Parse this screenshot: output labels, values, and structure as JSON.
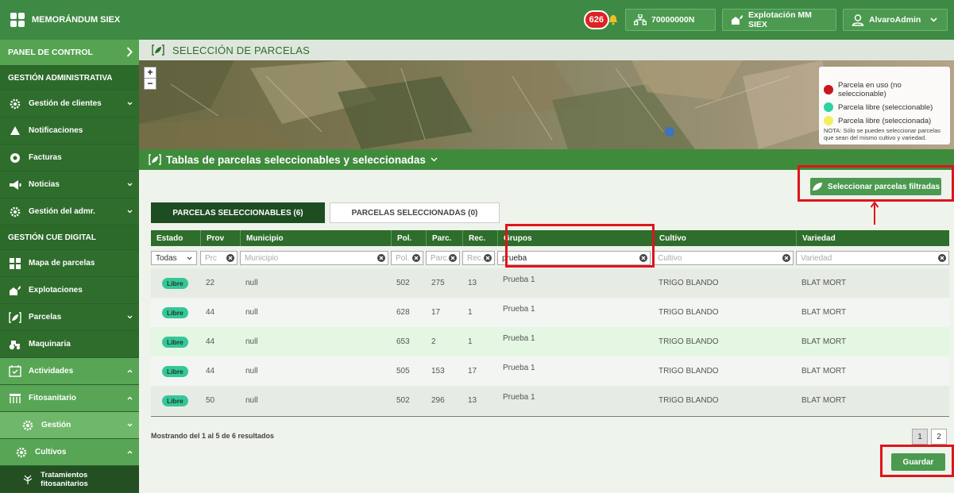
{
  "topbar": {
    "app_title": "MEMORÁNDUM SIEX",
    "notification_count": "626",
    "nif_label": "70000000N",
    "explotacion_label": "Explotación MM SIEX",
    "user_label": "AlvaroAdmin"
  },
  "sidebar": {
    "panel_label": "PANEL DE CONTROL",
    "section1": "GESTIÓN ADMINISTRATIVA",
    "items1": [
      {
        "label": "Gestión de clientes"
      },
      {
        "label": "Notificaciones"
      },
      {
        "label": "Facturas"
      },
      {
        "label": "Noticias"
      },
      {
        "label": "Gestión del admr."
      }
    ],
    "section2": "GESTIÓN CUE DIGITAL",
    "items2": [
      {
        "label": "Mapa de parcelas"
      },
      {
        "label": "Explotaciones"
      },
      {
        "label": "Parcelas"
      },
      {
        "label": "Maquinaria"
      },
      {
        "label": "Actividades"
      },
      {
        "label": "Fitosanitario"
      },
      {
        "label": "Gestión"
      },
      {
        "label": "Cultivos"
      },
      {
        "label": "Tratamientos fitosanitarios"
      }
    ]
  },
  "main": {
    "page_title": "SELECCIÓN DE PARCELAS",
    "legend": {
      "in_use": "Parcela en uso (no seleccionable)",
      "free": "Parcela libre (seleccionable)",
      "selected": "Parcela libre (seleccionada)",
      "note": "NOTA: Sólo se pueden seleccionar parcelas que sean del mismo cultivo y variedad.",
      "colors": {
        "in_use": "#c8171c",
        "free": "#2ed3a0",
        "selected": "#f3ef5a"
      }
    },
    "section_title": "Tablas de parcelas seleccionables y seleccionadas",
    "select_filtered_label": "Seleccionar parcelas filtradas",
    "tabs": [
      {
        "label": "PARCELAS SELECCIONABLES (6)"
      },
      {
        "label": "PARCELAS SELECCIONADAS (0)"
      }
    ],
    "table": {
      "headers": [
        "Estado",
        "Prov",
        "Municipio",
        "Pol.",
        "Parc.",
        "Rec.",
        "Grupos",
        "Cultivo",
        "Variedad"
      ],
      "filters": {
        "estado": "Todas",
        "prov_placeholder": "Prc",
        "municipio_placeholder": "Municipio",
        "pol_placeholder": "Pol.",
        "parc_placeholder": "Parc.",
        "rec_placeholder": "Rec.",
        "grupos_value": "prueba",
        "cultivo_placeholder": "Cultivo",
        "variedad_placeholder": "Variedad"
      },
      "rows": [
        {
          "estado": "Libre",
          "prov": "22",
          "municipio": "null",
          "pol": "502",
          "parc": "275",
          "rec": "13",
          "grupos": "Prueba 1",
          "cultivo": "TRIGO BLANDO",
          "variedad": "BLAT MORT"
        },
        {
          "estado": "Libre",
          "prov": "44",
          "municipio": "null",
          "pol": "628",
          "parc": "17",
          "rec": "1",
          "grupos": "Prueba 1",
          "cultivo": "TRIGO BLANDO",
          "variedad": "BLAT MORT"
        },
        {
          "estado": "Libre",
          "prov": "44",
          "municipio": "null",
          "pol": "653",
          "parc": "2",
          "rec": "1",
          "grupos": "Prueba 1",
          "cultivo": "TRIGO BLANDO",
          "variedad": "BLAT MORT"
        },
        {
          "estado": "Libre",
          "prov": "44",
          "municipio": "null",
          "pol": "505",
          "parc": "153",
          "rec": "17",
          "grupos": "Prueba 1",
          "cultivo": "TRIGO BLANDO",
          "variedad": "BLAT MORT"
        },
        {
          "estado": "Libre",
          "prov": "50",
          "municipio": "null",
          "pol": "502",
          "parc": "296",
          "rec": "13",
          "grupos": "Prueba 1",
          "cultivo": "TRIGO BLANDO",
          "variedad": "BLAT MORT"
        }
      ]
    },
    "results_text": "Mostrando del 1 al 5 de 6 resultados",
    "pages": [
      "1",
      "2"
    ],
    "save_label": "Guardar"
  }
}
